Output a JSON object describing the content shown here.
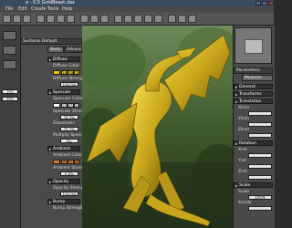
{
  "window": {
    "title": "o - 0,5 GoldBeast.daz"
  },
  "menubar": {
    "items": [
      "File",
      "Edit",
      "Create",
      "Tools",
      "Help"
    ]
  },
  "left_panel": {
    "header": "Surfaces Default",
    "tabs": [
      "Basic",
      "Advanced"
    ],
    "sections": [
      {
        "label": "Diffuse"
      },
      {
        "label": "Specular"
      },
      {
        "label": "Ambient"
      },
      {
        "label": "Opacity"
      },
      {
        "label": "Bump"
      }
    ],
    "labels": {
      "diffuse_color": "Diffuse Color",
      "diffuse_strength": "Diffuse Strength",
      "specular_color": "Specular Color",
      "specular_strength": "Specular Strength",
      "glossiness": "Glossiness",
      "multiply_specular": "Multiply Specular Throu...",
      "ambient_color": "Ambient Color",
      "ambient_strength": "Ambient Strength",
      "opacity_strength": "Opacity Strength"
    },
    "values": {
      "diffuse_rgb": [
        "244",
        "199",
        "3"
      ],
      "diffuse_strength": "100.0%",
      "specular_rgb": [
        "255",
        "255",
        "255"
      ],
      "specular_strength": "74.7%",
      "glossiness": "71.7%",
      "multiply_specular": "On",
      "ambient_rgb": [
        "0",
        "0",
        "0"
      ],
      "ambient_strength": "0.0%",
      "opacity_strength": "100.0%"
    },
    "misc": {
      "col1_values": [
        "255",
        "255"
      ],
      "bottom_label": "Bump Strength"
    }
  },
  "right_panel": {
    "header": "Parameters",
    "tab": "Malacon",
    "sections": [
      {
        "label": "General"
      },
      {
        "label": "Transforms"
      },
      {
        "label": "Translation"
      },
      {
        "label": "Rotation"
      },
      {
        "label": "Scale"
      }
    ],
    "rows": [
      "Xtran",
      "Ytran",
      "Ztran",
      "Xrot",
      "Yrot",
      "Zrot",
      "Scale",
      "Xscale"
    ],
    "values": {
      "scale": "100%"
    }
  },
  "colors": {
    "accent_diffuse": "#f4c703",
    "accent_ambient": "#d87a28",
    "panel_bg": "#4b4b4b",
    "title_bg": "#3a4a5f",
    "dragon_gold": "#c9a61b"
  }
}
